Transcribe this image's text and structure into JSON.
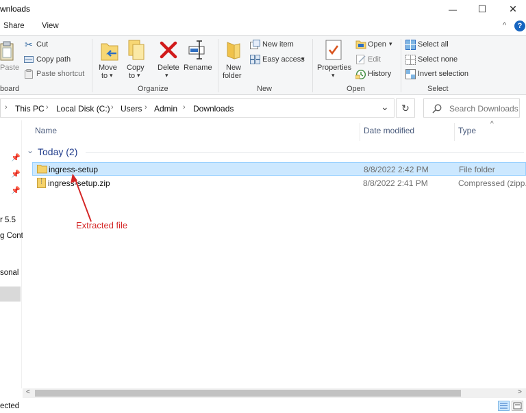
{
  "window": {
    "title": "wnloads",
    "min_glyph": "—",
    "max_glyph": "☐",
    "close_glyph": "✕"
  },
  "ribbon_tabs": [
    {
      "label": "Share"
    },
    {
      "label": "View"
    }
  ],
  "help_glyph": "?",
  "collapse_glyph": "^",
  "ribbon": {
    "clipboard": {
      "paste": "Paste",
      "cut": "Cut",
      "copy_path": "Copy path",
      "paste_shortcut": "Paste shortcut",
      "group": "board"
    },
    "organize": {
      "move_to_1": "Move",
      "move_to_2": "to",
      "copy_to_1": "Copy",
      "copy_to_2": "to",
      "delete": "Delete",
      "rename": "Rename",
      "group": "Organize"
    },
    "new": {
      "new_folder_1": "New",
      "new_folder_2": "folder",
      "new_item": "New item",
      "easy_access": "Easy access",
      "group": "New"
    },
    "open": {
      "properties": "Properties",
      "open": "Open",
      "edit": "Edit",
      "history": "History",
      "group": "Open"
    },
    "select": {
      "select_all": "Select all",
      "select_none": "Select none",
      "invert_selection": "Invert selection",
      "group": "Select"
    },
    "dropdown_glyph": "▾"
  },
  "address": {
    "crumbs": [
      "This PC",
      "Local Disk (C:)",
      "Users",
      "Admin",
      "Downloads"
    ],
    "sep_glyph": "›",
    "dropdown_glyph": "⌄",
    "refresh_glyph": "↻"
  },
  "search": {
    "placeholder": "Search Downloads"
  },
  "nav": {
    "items": [
      "r 5.5",
      "g Cont",
      "sonal"
    ]
  },
  "columns": {
    "name": "Name",
    "date": "Date modified",
    "type": "Type",
    "sort_glyph": "^"
  },
  "group": {
    "label": "Today (2)",
    "chevron": "⌄"
  },
  "files": [
    {
      "name": "ingress-setup",
      "date": "8/8/2022 2:42 PM",
      "type": "File folder",
      "selected": true
    },
    {
      "name": "ingress-setup.zip",
      "date": "8/8/2022 2:41 PM",
      "type": "Compressed (zipp..",
      "selected": false
    }
  ],
  "annotation": {
    "text": "Extracted file",
    "color": "#d42626"
  },
  "scroll": {
    "left_glyph": "<",
    "right_glyph": ">"
  },
  "status": {
    "text": "ected"
  },
  "colors": {
    "selection": "#cce8ff",
    "accent": "#1765c0",
    "group_text": "#1e3a8a"
  }
}
